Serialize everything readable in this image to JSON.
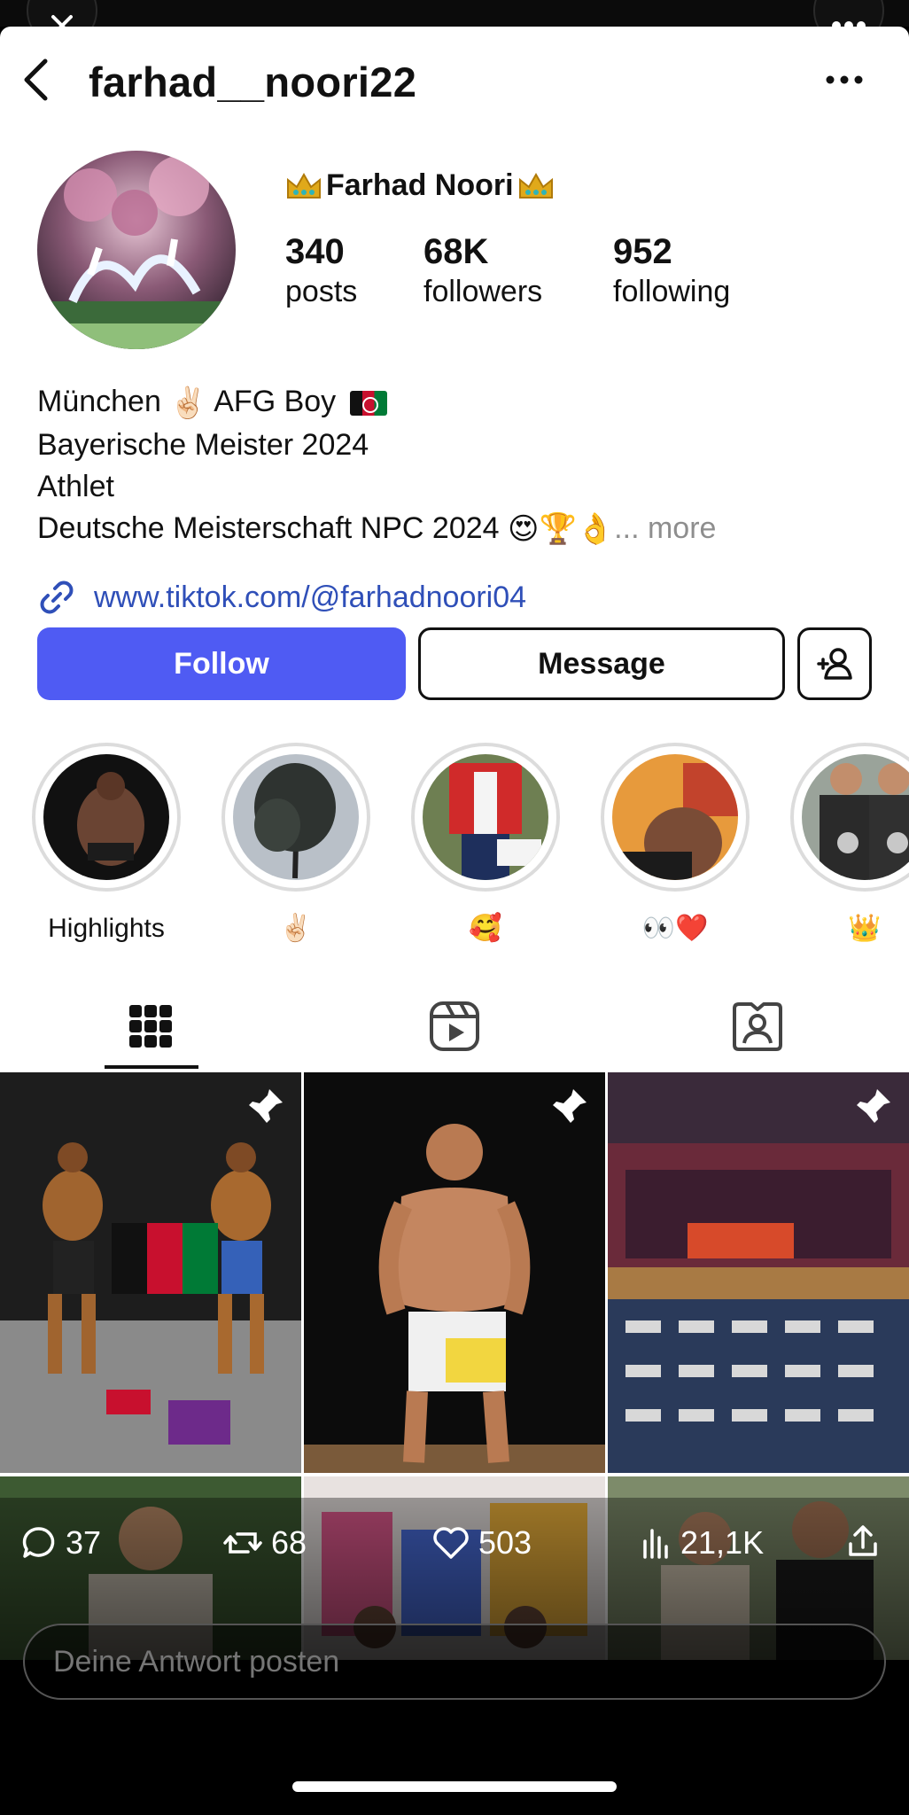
{
  "profile": {
    "username": "farhad__noori22",
    "display_name": "Farhad Noori",
    "stats": [
      {
        "value": "340",
        "label": "posts"
      },
      {
        "value": "68K",
        "label": "followers"
      },
      {
        "value": "952",
        "label": "following"
      }
    ],
    "bio_lines": [
      "München",
      "AFG Boy",
      "Bayerische Meister 2024",
      "Athlet",
      "Deutsche Meisterschaft NPC 2024"
    ],
    "bio_more": "... more",
    "link": "www.tiktok.com/@farhadnoori04"
  },
  "actions": {
    "follow": "Follow",
    "message": "Message"
  },
  "highlights": [
    {
      "label": "Highlights"
    },
    {
      "label": "✌🏻"
    },
    {
      "label": "🥰"
    },
    {
      "label": "👀❤️"
    },
    {
      "label": "👑"
    }
  ],
  "tweet_stats": {
    "replies": "37",
    "reposts": "68",
    "likes": "503",
    "views": "21,1K"
  },
  "reply": {
    "placeholder": "Deine Antwort posten"
  },
  "colors": {
    "follow_button": "#4f5bf3",
    "link": "#2f4fb8",
    "more_text": "#8e8e8e"
  }
}
